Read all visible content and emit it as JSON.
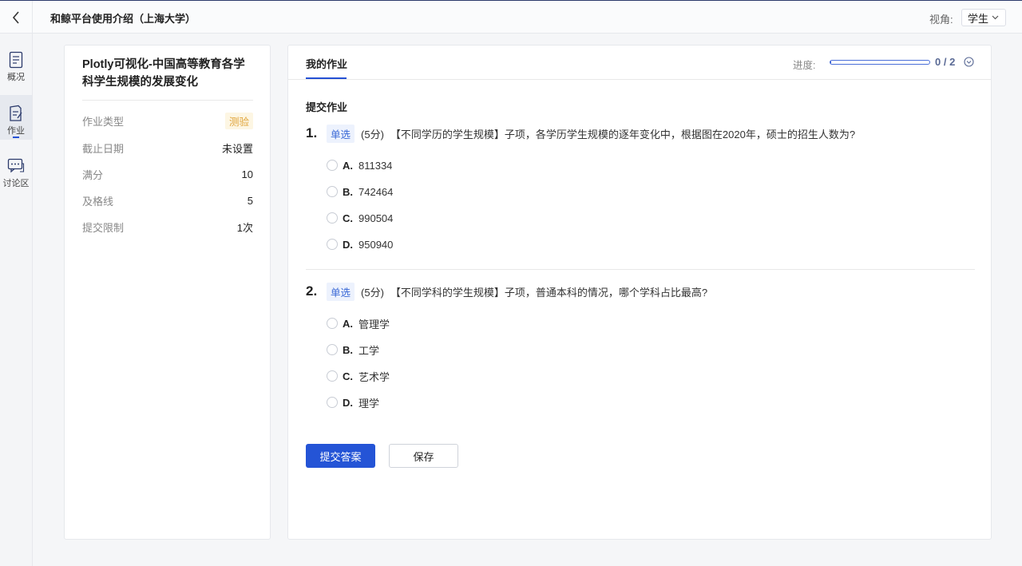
{
  "header": {
    "title": "和鲸平台使用介绍（上海大学）",
    "view_label": "视角:",
    "view_value": "学生"
  },
  "sidebar": {
    "items": [
      {
        "label": "概况",
        "icon": "overview-icon"
      },
      {
        "label": "作业",
        "icon": "assignment-icon",
        "active": true
      },
      {
        "label": "讨论区",
        "icon": "discussion-icon"
      }
    ]
  },
  "assignment": {
    "title": "Plotly可视化-中国高等教育各学科学生规模的发展变化",
    "info": [
      {
        "key": "作业类型",
        "value": "测验"
      },
      {
        "key": "截止日期",
        "value": "未设置"
      },
      {
        "key": "满分",
        "value": "10"
      },
      {
        "key": "及格线",
        "value": "5"
      },
      {
        "key": "提交限制",
        "value": "1次"
      }
    ]
  },
  "main": {
    "tab_label": "我的作业",
    "progress_label": "进度:",
    "progress_value": 0,
    "progress_count": "0 / 2",
    "section_title": "提交作业",
    "questions": [
      {
        "number": "1.",
        "type": "单选",
        "score": "(5分)",
        "text": "【不同学历的学生规模】子项，各学历学生规模的逐年变化中，根据图在2020年，硕士的招生人数为?",
        "options": [
          {
            "letter": "A.",
            "text": "811334"
          },
          {
            "letter": "B.",
            "text": "742464"
          },
          {
            "letter": "C.",
            "text": "990504"
          },
          {
            "letter": "D.",
            "text": "950940"
          }
        ]
      },
      {
        "number": "2.",
        "type": "单选",
        "score": "(5分)",
        "text": "【不同学科的学生规模】子项，普通本科的情况，哪个学科占比最高?",
        "options": [
          {
            "letter": "A.",
            "text": "管理学"
          },
          {
            "letter": "B.",
            "text": "工学"
          },
          {
            "letter": "C.",
            "text": "艺术学"
          },
          {
            "letter": "D.",
            "text": "理学"
          }
        ]
      }
    ],
    "submit_label": "提交答案",
    "save_label": "保存"
  },
  "colors": {
    "accent": "#2454d6",
    "tag_quiz_text": "#e0a43a",
    "tag_quiz_bg": "#fdf6e3"
  }
}
